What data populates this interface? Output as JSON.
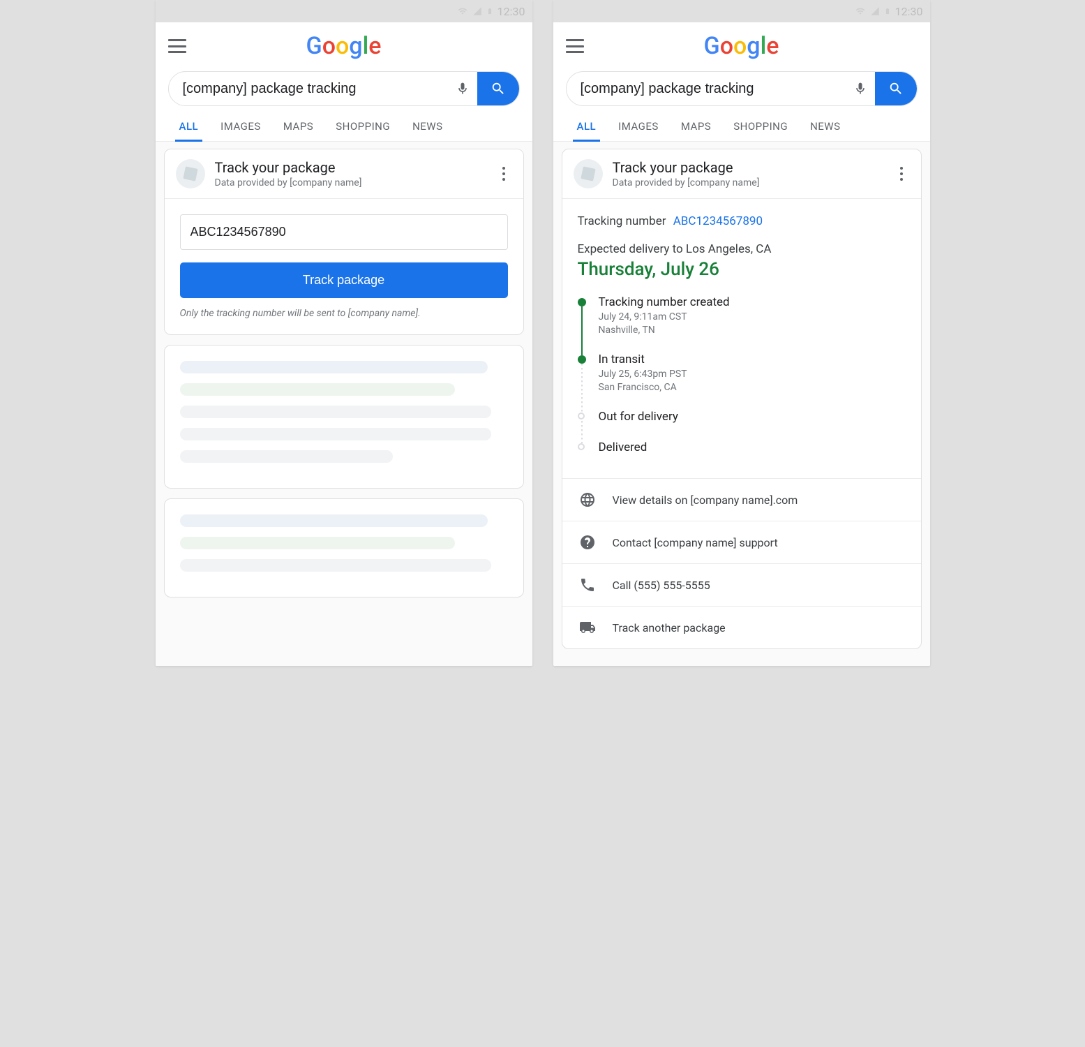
{
  "status_bar": {
    "time": "12:30"
  },
  "search": {
    "query": "[company] package tracking"
  },
  "tabs": [
    "ALL",
    "IMAGES",
    "MAPS",
    "SHOPPING",
    "NEWS"
  ],
  "card": {
    "title": "Track your package",
    "subtitle": "Data provided by [company name]",
    "tracking_input_value": "ABC1234567890",
    "track_button": "Track package",
    "disclaimer": "Only the tracking number will be sent to [company name]."
  },
  "result": {
    "tracking_label": "Tracking number",
    "tracking_number": "ABC1234567890",
    "expected_label": "Expected delivery to Los Angeles, CA",
    "expected_date": "Thursday, July 26",
    "timeline": [
      {
        "title": "Tracking number created",
        "time": "July 24, 9:11am CST",
        "loc": "Nashville, TN",
        "state": "done"
      },
      {
        "title": "In transit",
        "time": "July 25, 6:43pm PST",
        "loc": "San Francisco, CA",
        "state": "done"
      },
      {
        "title": "Out for delivery",
        "time": "",
        "loc": "",
        "state": "pending"
      },
      {
        "title": "Delivered",
        "time": "",
        "loc": "",
        "state": "pending"
      }
    ],
    "actions": {
      "view_details": "View details on [company name].com",
      "contact_support": "Contact [company name] support",
      "call": "Call (555) 555-5555",
      "track_another": "Track another package"
    }
  }
}
